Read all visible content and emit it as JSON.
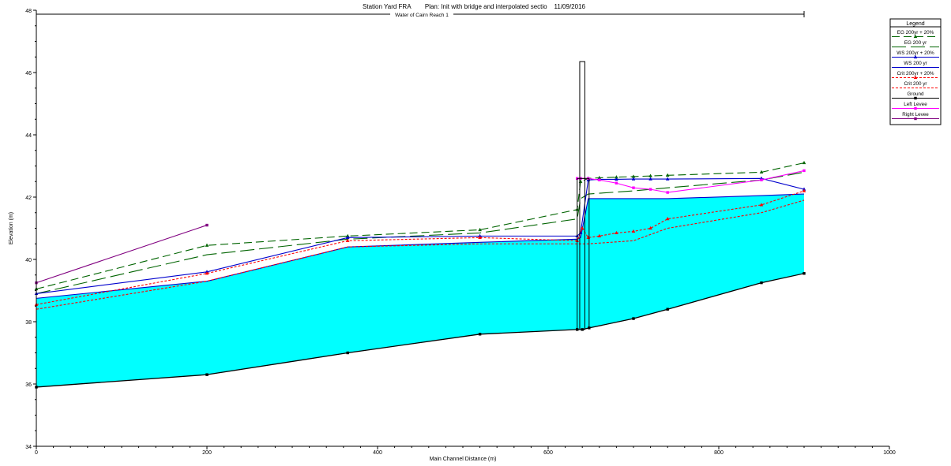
{
  "header": {
    "title": "Station Yard FRA        Plan: Init with bridge and interpolated sectio    11/09/2016",
    "reach_label": "Water of Cairn Reach 1"
  },
  "chart_data": {
    "type": "line",
    "xlabel": "Main Channel Distance (m)",
    "ylabel": "Elevation (m)",
    "xlim": [
      0,
      1000
    ],
    "ylim": [
      34,
      48
    ],
    "x_ticks": [
      0,
      200,
      400,
      600,
      800,
      1000
    ],
    "y_ticks": [
      34,
      36,
      38,
      40,
      42,
      44,
      46,
      48
    ],
    "legend_title": "Legend",
    "legend_position": "top-right",
    "grid": false,
    "water_fill_color": "#00ffff",
    "series": [
      {
        "name": "EG 200yr + 20%",
        "color": "#006400",
        "dash": "10,5",
        "marker": "triangle",
        "x": [
          0,
          200,
          365,
          520,
          634,
          638,
          647,
          660,
          680,
          700,
          720,
          740,
          850,
          900
        ],
        "y": [
          39.05,
          40.45,
          40.75,
          40.95,
          41.6,
          42.5,
          42.6,
          42.62,
          42.64,
          42.66,
          42.68,
          42.7,
          42.8,
          43.1
        ]
      },
      {
        "name": "EG 200 yr",
        "color": "#006400",
        "dash": "18,6",
        "marker": "none",
        "x": [
          0,
          200,
          365,
          520,
          634,
          638,
          647,
          700,
          740,
          850,
          900
        ],
        "y": [
          38.9,
          40.15,
          40.65,
          40.85,
          41.3,
          41.95,
          42.1,
          42.2,
          42.3,
          42.55,
          42.8
        ]
      },
      {
        "name": "WS 200yr + 20%",
        "color": "#0000cd",
        "dash": "",
        "marker": "triangle",
        "x": [
          0,
          200,
          365,
          520,
          634,
          638,
          647,
          660,
          680,
          700,
          720,
          740,
          850,
          900
        ],
        "y": [
          38.9,
          39.6,
          40.7,
          40.75,
          40.75,
          40.85,
          42.55,
          42.57,
          42.57,
          42.58,
          42.58,
          42.58,
          42.6,
          42.25
        ]
      },
      {
        "name": "WS 200 yr",
        "color": "#0000cd",
        "dash": "",
        "marker": "none",
        "x": [
          0,
          200,
          365,
          520,
          634,
          638,
          647,
          700,
          740,
          850,
          900
        ],
        "y": [
          38.75,
          39.3,
          40.4,
          40.55,
          40.65,
          40.7,
          41.95,
          41.95,
          41.95,
          42.05,
          42.1
        ]
      },
      {
        "name": "Crit 200yr + 20%",
        "color": "#ff0000",
        "dash": "3,2",
        "marker": "triangle",
        "x": [
          0,
          200,
          365,
          520,
          634,
          640,
          647,
          660,
          680,
          700,
          720,
          740,
          850,
          900
        ],
        "y": [
          38.55,
          39.55,
          40.6,
          40.7,
          40.6,
          41.0,
          40.7,
          40.75,
          40.85,
          40.9,
          41.0,
          41.3,
          41.75,
          42.2
        ]
      },
      {
        "name": "Crit 200 yr",
        "color": "#ff0000",
        "dash": "3,2",
        "marker": "none",
        "x": [
          0,
          200,
          365,
          520,
          634,
          647,
          700,
          740,
          850,
          900
        ],
        "y": [
          38.4,
          39.3,
          40.4,
          40.5,
          40.5,
          40.5,
          40.6,
          41.0,
          41.5,
          41.9
        ]
      },
      {
        "name": "Ground",
        "color": "#000000",
        "dash": "",
        "marker": "square",
        "x": [
          0,
          200,
          365,
          520,
          634,
          640,
          648,
          700,
          740,
          850,
          900
        ],
        "y": [
          35.9,
          36.3,
          37.0,
          37.6,
          37.75,
          37.75,
          37.8,
          38.1,
          38.4,
          39.25,
          39.55
        ]
      },
      {
        "name": "Left Levee",
        "color": "#ff00ff",
        "dash": "",
        "marker": "square",
        "x": [
          634,
          638,
          647,
          660,
          680,
          700,
          720,
          740,
          850,
          900
        ],
        "y": [
          42.6,
          42.6,
          42.6,
          42.55,
          42.45,
          42.3,
          42.25,
          42.15,
          42.55,
          42.85
        ]
      },
      {
        "name": "Right Levee",
        "color": "#800080",
        "dash": "",
        "marker": "square",
        "x": [
          0,
          200
        ],
        "y": [
          39.25,
          41.1
        ]
      }
    ],
    "bridge": {
      "deck_top": 46.35,
      "low_chord": 42.6,
      "x_us": 634,
      "x_ds": 648,
      "pier_x": [
        637,
        643
      ]
    }
  }
}
